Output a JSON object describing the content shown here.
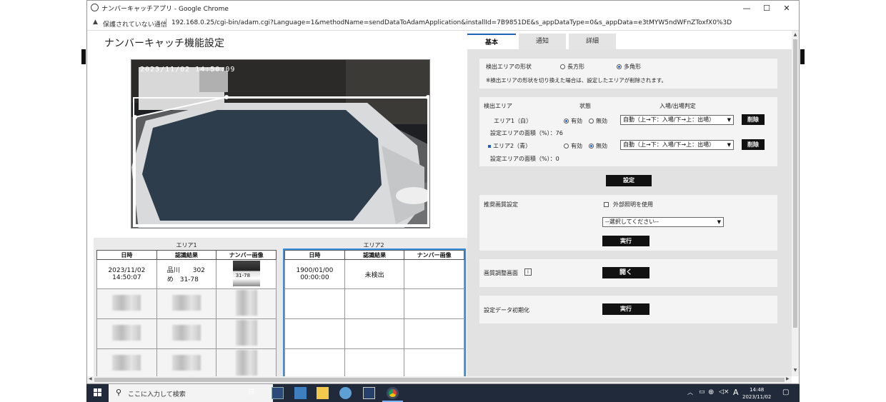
{
  "window": {
    "title": "ナンバーキャッチアプリ - Google Chrome",
    "controls": {
      "minimize": "—",
      "maximize": "☐",
      "close": "✕"
    }
  },
  "address": {
    "security_text": "保護されていない通信",
    "url": "192.168.0.25/cgi-bin/adam.cgi?Language=1&methodName=sendDataToAdamApplication&installId=7B9851DE&s_appDataType=0&s_appData=e3tMYW5ndWFnZToxfX0%3D"
  },
  "page": {
    "title": "ナンバーキャッチ機能設定",
    "camera_timestamp": "2023/11/02 14:50:09"
  },
  "results": {
    "area1": {
      "label": "エリア1",
      "headers": [
        "日時",
        "認識結果",
        "ナンバー画像"
      ],
      "row": {
        "date": "2023/11/02",
        "time": "14:50:07",
        "plate_line1": "品川　　302",
        "plate_line2": "め　31-78",
        "plate_image_text": "31-78"
      }
    },
    "area2": {
      "label": "エリア2",
      "headers": [
        "日時",
        "認識結果",
        "ナンバー画像"
      ],
      "row": {
        "date": "1900/01/00",
        "time": "00:00:00",
        "result": "未検出"
      }
    }
  },
  "tabs": [
    "基本",
    "通知",
    "詳細"
  ],
  "shape_panel": {
    "label": "検出エリアの形状",
    "options": [
      "長方形",
      "多角形"
    ],
    "selected": "多角形",
    "note": "※検出エリアの形状を切り換えた場合は、設定したエリアが削除されます。"
  },
  "area_panel": {
    "col_area": "検出エリア",
    "col_state": "状態",
    "col_judge": "入場/出場判定",
    "area1": {
      "name": "エリア1（白）",
      "on": "有効",
      "off": "無効",
      "state": "有効",
      "judge": "自動（上→下：入場/下→上：出場）",
      "area_text": "設定エリアの面積（%）：76",
      "delete": "削除"
    },
    "area2": {
      "name": "エリア2（青）",
      "on": "有効",
      "off": "無効",
      "state": "無効",
      "judge": "自動（上→下：入場/下→上：出場）",
      "area_text": "設定エリアの面積（%）：0",
      "delete": "削除"
    },
    "set_button": "設定"
  },
  "quality_panel": {
    "label": "推奨画質設定",
    "checkbox_label": "外部照明を使用",
    "select_placeholder": "--選択してください--",
    "run_button": "実行"
  },
  "adjust_panel": {
    "label": "画質調整画面",
    "info": "i",
    "open_button": "開く"
  },
  "init_panel": {
    "label": "設定データ初期化",
    "run_button": "実行"
  },
  "taskbar": {
    "search_placeholder": "ここに入力して検索",
    "ime": "A",
    "time": "14:48",
    "date": "2023/11/02"
  },
  "colors": {
    "accent_blue": "#1c64b4",
    "area2_border": "#3a8fdc",
    "taskbar": "#202a3a"
  }
}
